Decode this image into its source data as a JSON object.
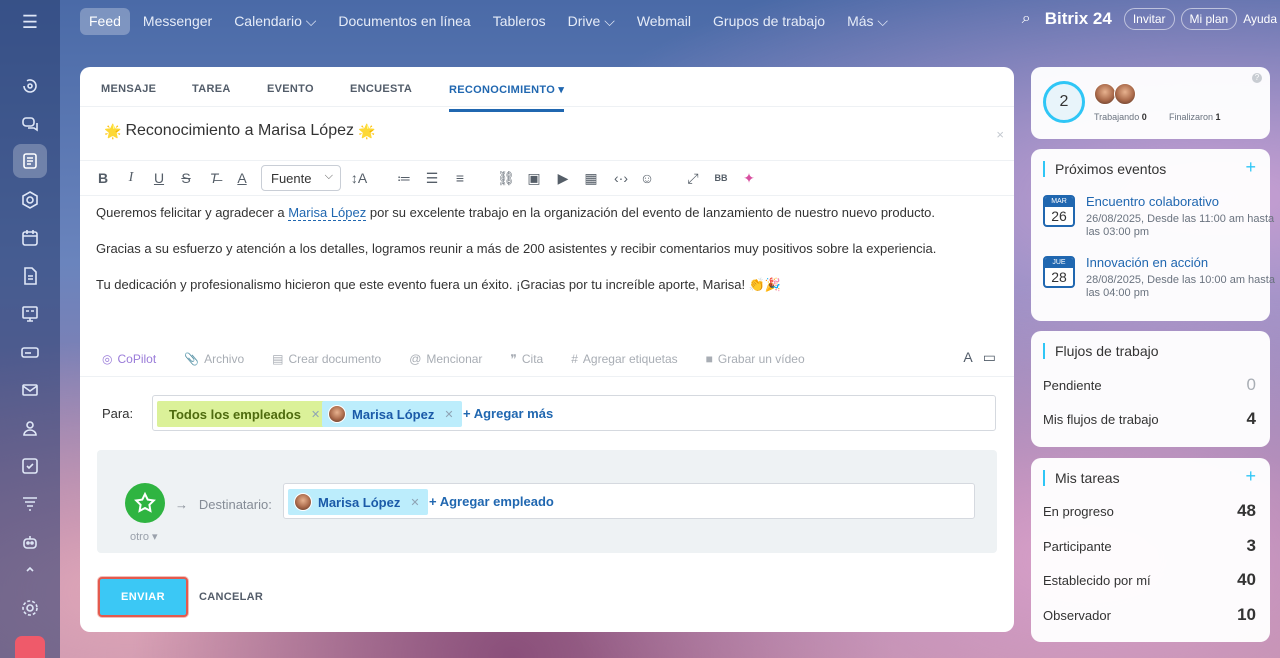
{
  "nav": {
    "items": [
      "Feed",
      "Messenger",
      "Calendario ⌵",
      "Documentos en línea",
      "Tableros",
      "Drive ⌵",
      "Webmail",
      "Grupos de trabajo",
      "Más ⌵"
    ],
    "brand": "Bitrix 24",
    "invite": "Invitar",
    "plan": "Mi plan",
    "help": "Ayuda"
  },
  "composer": {
    "tabs": [
      "MENSAJE",
      "TAREA",
      "EVENTO",
      "ENCUESTA",
      "RECONOCIMIENTO"
    ],
    "active_tab_arrow": "▾",
    "title": "Reconocimiento a Marisa López",
    "toolbar": {
      "font": "Fuente"
    },
    "body": {
      "p1_a": "Queremos felicitar y agradecer a ",
      "p1_mention": "Marisa López",
      "p1_b": " por su excelente trabajo en la organización del evento de lanzamiento de nuestro nuevo producto.",
      "p2": "Gracias a su esfuerzo y atención a los detalles, logramos reunir a más de 200 asistentes y recibir comentarios muy positivos sobre la experiencia.",
      "p3": "Tu dedicación y profesionalismo hicieron que este evento fuera un éxito. ¡Gracias por tu increíble aporte, Marisa! 👏🎉"
    },
    "attachments": [
      "CoPilot",
      "Archivo",
      "Crear documento",
      "Mencionar",
      "Cita",
      "Agregar etiquetas",
      "Grabar un vídeo"
    ],
    "to_label": "Para:",
    "to_chips": [
      "Todos los empleados",
      "Marisa López"
    ],
    "add_more": "+ Agregar más",
    "recipient_label": "Destinatario:",
    "recipient_chip": "Marisa López",
    "add_employee": "+ Agregar empleado",
    "badge_label": "otro",
    "send": "ENVIAR",
    "cancel": "CANCELAR"
  },
  "pulse": {
    "count": "2",
    "working_label": "Trabajando",
    "working_value": "0",
    "finished_label": "Finalizaron",
    "finished_value": "1"
  },
  "events": {
    "title": "Próximos eventos",
    "items": [
      {
        "month": "MAR",
        "day": "26",
        "title": "Encuentro colaborativo",
        "time": "26/08/2025, Desde las 11:00 am hasta las 03:00 pm"
      },
      {
        "month": "JUE",
        "day": "28",
        "title": "Innovación en acción",
        "time": "28/08/2025, Desde las 10:00 am hasta las 04:00 pm"
      }
    ]
  },
  "workflows": {
    "title": "Flujos de trabajo",
    "rows": [
      {
        "label": "Pendiente",
        "value": "0"
      },
      {
        "label": "Mis flujos de trabajo",
        "value": "4"
      }
    ]
  },
  "tasks": {
    "title": "Mis tareas",
    "rows": [
      {
        "label": "En progreso",
        "value": "48"
      },
      {
        "label": "Participante",
        "value": "3"
      },
      {
        "label": "Establecido por mí",
        "value": "40"
      },
      {
        "label": "Observador",
        "value": "10"
      }
    ]
  },
  "colors": {
    "accent": "#2fc6f6",
    "link": "#2067b0",
    "send": "#3bc8f5",
    "highlight_border": "#e35a4e"
  }
}
